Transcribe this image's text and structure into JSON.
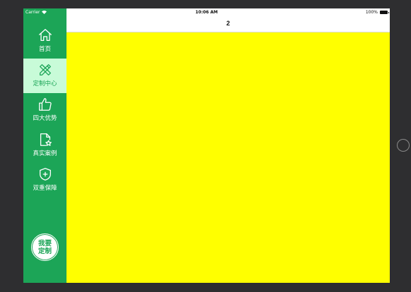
{
  "status_bar": {
    "carrier": "Carrier",
    "time": "10:06 AM",
    "battery": "100%"
  },
  "header": {
    "title": "2"
  },
  "sidebar": {
    "items": [
      {
        "label": "首页",
        "icon": "home-icon",
        "active": false
      },
      {
        "label": "定制中心",
        "icon": "pencil-ruler-icon",
        "active": true
      },
      {
        "label": "四大优势",
        "icon": "thumbs-up-icon",
        "active": false
      },
      {
        "label": "真实案例",
        "icon": "document-star-icon",
        "active": false
      },
      {
        "label": "双重保障",
        "icon": "shield-plus-icon",
        "active": false
      }
    ],
    "custom_button": {
      "line1": "我要",
      "line2": "定制"
    }
  },
  "colors": {
    "sidebar_bg": "#1ca557",
    "active_bg": "#c8fbd8",
    "content_bg": "#ffff00",
    "frame_bg": "#2e2e30"
  }
}
